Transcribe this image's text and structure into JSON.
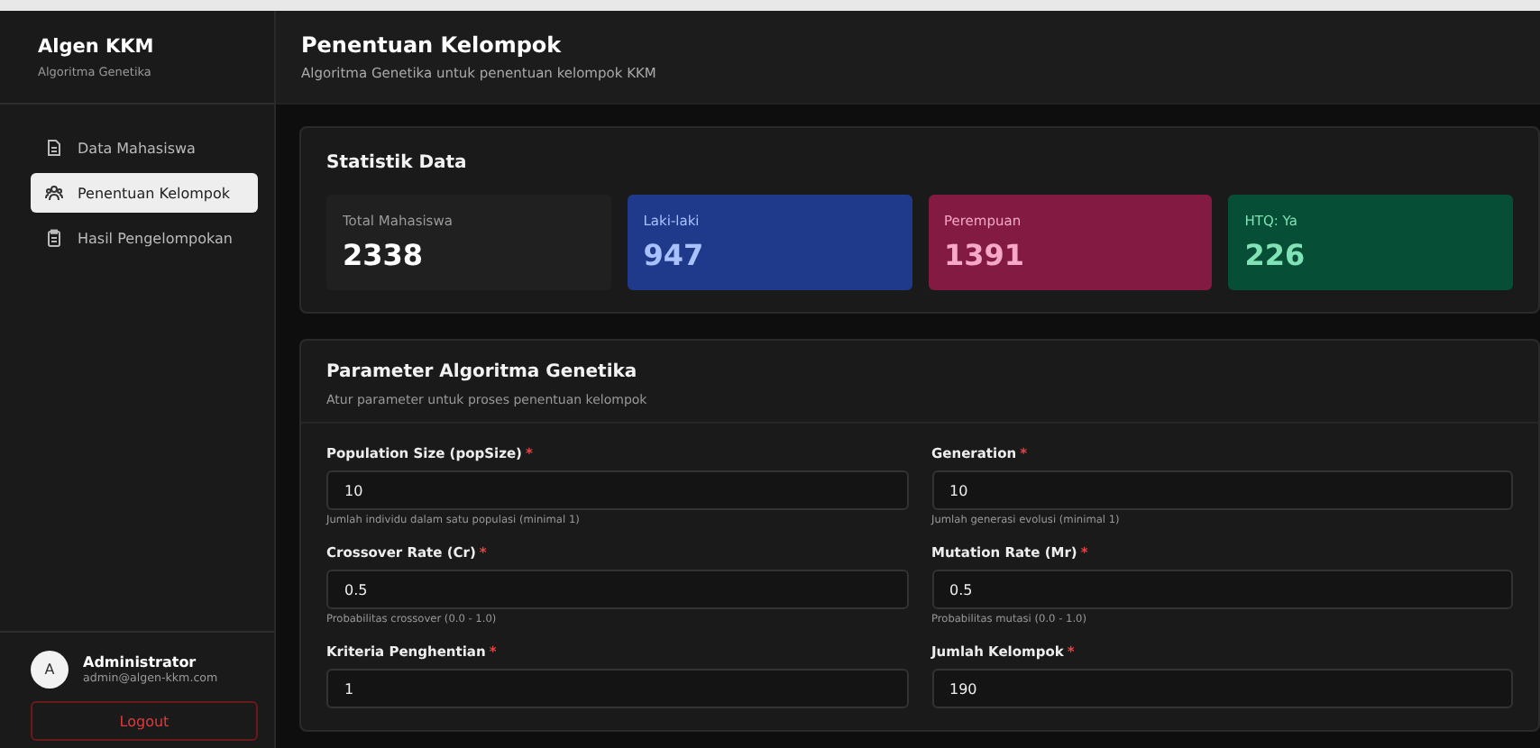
{
  "sidebar": {
    "brand": "Algen KKM",
    "subtitle": "Algoritma Genetika",
    "items": [
      {
        "label": "Data Mahasiswa",
        "kind": "document",
        "selected": false
      },
      {
        "label": "Penentuan Kelompok",
        "kind": "group",
        "selected": true
      },
      {
        "label": "Hasil Pengelompokan",
        "kind": "clipboard",
        "selected": false
      }
    ],
    "user": {
      "avatar": "A",
      "name": "Administrator",
      "email": "admin@algen-kkm.com"
    },
    "logout": "Logout"
  },
  "header": {
    "title": "Penentuan Kelompok",
    "subtitle": "Algoritma Genetika untuk penentuan kelompok KKM"
  },
  "stats": {
    "title": "Statistik Data",
    "cards": [
      {
        "label": "Total Mahasiswa",
        "value": "2338",
        "kind": "neutral"
      },
      {
        "label": "Laki-laki",
        "value": "947",
        "kind": "blue"
      },
      {
        "label": "Perempuan",
        "value": "1391",
        "kind": "pink"
      },
      {
        "label": "HTQ: Ya",
        "value": "226",
        "kind": "green"
      }
    ]
  },
  "parameters": {
    "title": "Parameter Algoritma Genetika",
    "subtitle": "Atur parameter untuk proses penentuan kelompok",
    "fields": [
      {
        "label": "Population Size (popSize)",
        "required_mark": "*",
        "value": "10",
        "hint": "Jumlah individu dalam satu populasi (minimal 1)"
      },
      {
        "label": "Generation",
        "required_mark": "*",
        "value": "10",
        "hint": "Jumlah generasi evolusi (minimal 1)"
      },
      {
        "label": "Crossover Rate (Cr)",
        "required_mark": "*",
        "value": "0.5",
        "hint": "Probabilitas crossover (0.0 - 1.0)"
      },
      {
        "label": "Mutation Rate (Mr)",
        "required_mark": "*",
        "value": "0.5",
        "hint": "Probabilitas mutasi (0.0 - 1.0)"
      },
      {
        "label": "Kriteria Penghentian",
        "required_mark": "*",
        "value": "1"
      },
      {
        "label": "Jumlah Kelompok",
        "required_mark": "*",
        "value": "190"
      }
    ]
  }
}
